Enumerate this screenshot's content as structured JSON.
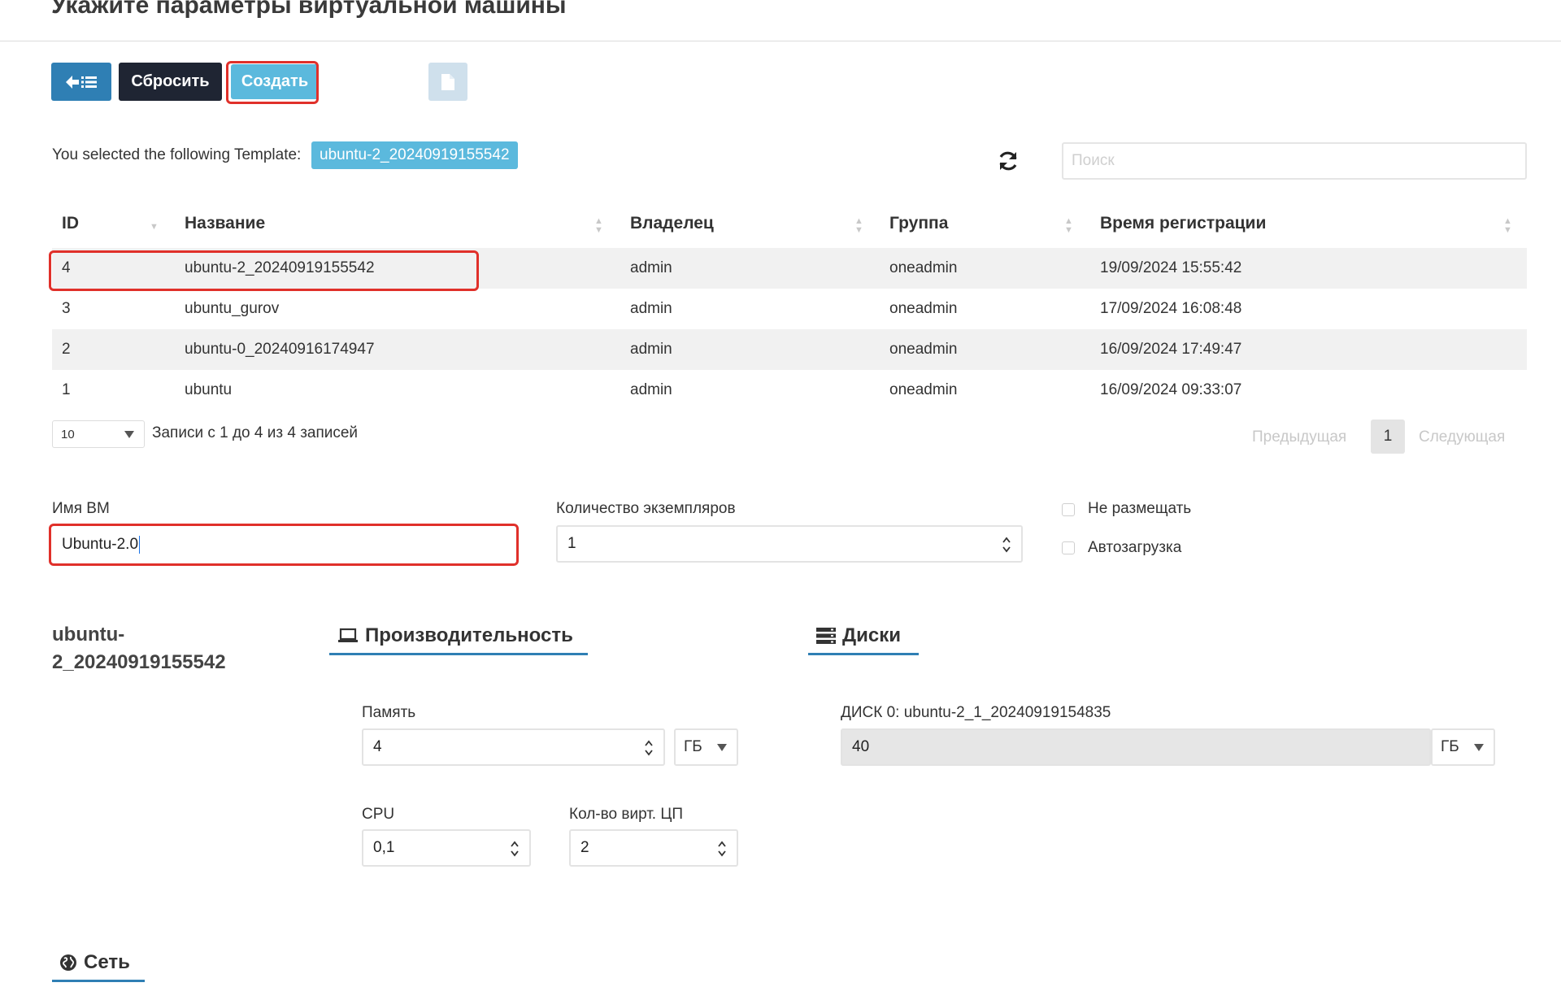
{
  "page": {
    "title": "Укажите параметры виртуальной машины"
  },
  "toolbar": {
    "back_icon": "back-list-icon",
    "reset_label": "Сбросить",
    "create_label": "Создать",
    "doc_icon": "document-icon"
  },
  "template_selection": {
    "text": "You selected the following Template:",
    "selected": "ubuntu-2_20240919155542",
    "refresh_icon": "refresh-icon",
    "search_placeholder": "Поиск"
  },
  "table": {
    "columns": [
      "ID",
      "Название",
      "Владелец",
      "Группа",
      "Время регистрации"
    ],
    "rows": [
      {
        "id": "4",
        "name": "ubuntu-2_20240919155542",
        "owner": "admin",
        "group": "oneadmin",
        "time": "19/09/2024 15:55:42"
      },
      {
        "id": "3",
        "name": "ubuntu_gurov",
        "owner": "admin",
        "group": "oneadmin",
        "time": "17/09/2024 16:08:48"
      },
      {
        "id": "2",
        "name": "ubuntu-0_20240916174947",
        "owner": "admin",
        "group": "oneadmin",
        "time": "16/09/2024 17:49:47"
      },
      {
        "id": "1",
        "name": "ubuntu",
        "owner": "admin",
        "group": "oneadmin",
        "time": "16/09/2024 09:33:07"
      }
    ],
    "page_length": "10",
    "info": "Записи с 1 до 4 из 4 записей",
    "prev_label": "Предыдущая",
    "current_page": "1",
    "next_label": "Следующая"
  },
  "vm_form": {
    "name_label": "Имя ВМ",
    "name_value": "Ubuntu-2.0",
    "instances_label": "Количество экземпляров",
    "instances_value": "1",
    "hold_label": "Не размещать",
    "autostart_label": "Автозагрузка"
  },
  "template_name": "ubuntu-2_20240919155542",
  "tabs": {
    "performance": "Производительность",
    "disks": "Диски",
    "network": "Сеть"
  },
  "performance": {
    "memory_label": "Память",
    "memory_value": "4",
    "memory_unit": "ГБ",
    "cpu_label": "CPU",
    "cpu_value": "0,1",
    "vcpu_label": "Кол-во вирт. ЦП",
    "vcpu_value": "2"
  },
  "disks": {
    "disk0_label": "ДИСК 0: ubuntu-2_1_20240919154835",
    "disk0_value": "40",
    "disk0_unit": "ГБ"
  },
  "colors": {
    "primary": "#2f7fb4",
    "dark_button": "#1f2533",
    "create_button": "#5bb9dd",
    "highlight": "#e0302a"
  }
}
